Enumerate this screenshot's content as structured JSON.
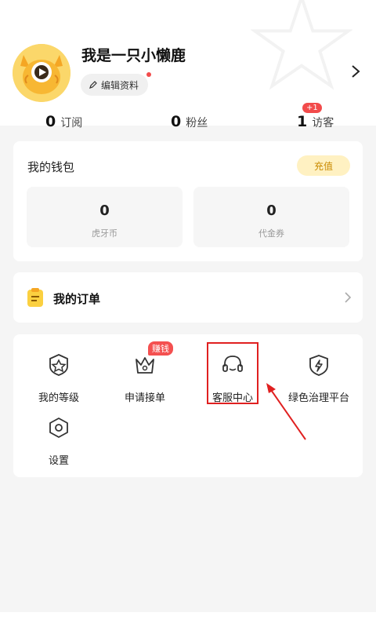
{
  "profile": {
    "username": "我是一只小懒鹿",
    "edit_label": "编辑资料"
  },
  "stats": {
    "subscriptions": {
      "count": "0",
      "label": "订阅"
    },
    "fans": {
      "count": "0",
      "label": "粉丝"
    },
    "visitors": {
      "count": "1",
      "label": "访客",
      "badge": "+1"
    }
  },
  "wallet": {
    "title": "我的钱包",
    "recharge_label": "充值",
    "items": [
      {
        "value": "0",
        "label": "虎牙币"
      },
      {
        "value": "0",
        "label": "代金券"
      }
    ]
  },
  "orders": {
    "label": "我的订单"
  },
  "menu": {
    "earn_badge": "赚钱",
    "items": [
      {
        "label": "我的等级",
        "icon": "level-badge-icon"
      },
      {
        "label": "申请接单",
        "icon": "crown-icon"
      },
      {
        "label": "客服中心",
        "icon": "headset-icon"
      },
      {
        "label": "绿色治理平台",
        "icon": "shield-bolt-icon"
      },
      {
        "label": "设置",
        "icon": "settings-hex-icon"
      }
    ]
  },
  "colors": {
    "accent_red": "#e02020",
    "badge_red": "#f24b4b",
    "recharge_bg": "#fff1c2",
    "recharge_text": "#c98a00",
    "avatar_yellow": "#fbd76a"
  }
}
